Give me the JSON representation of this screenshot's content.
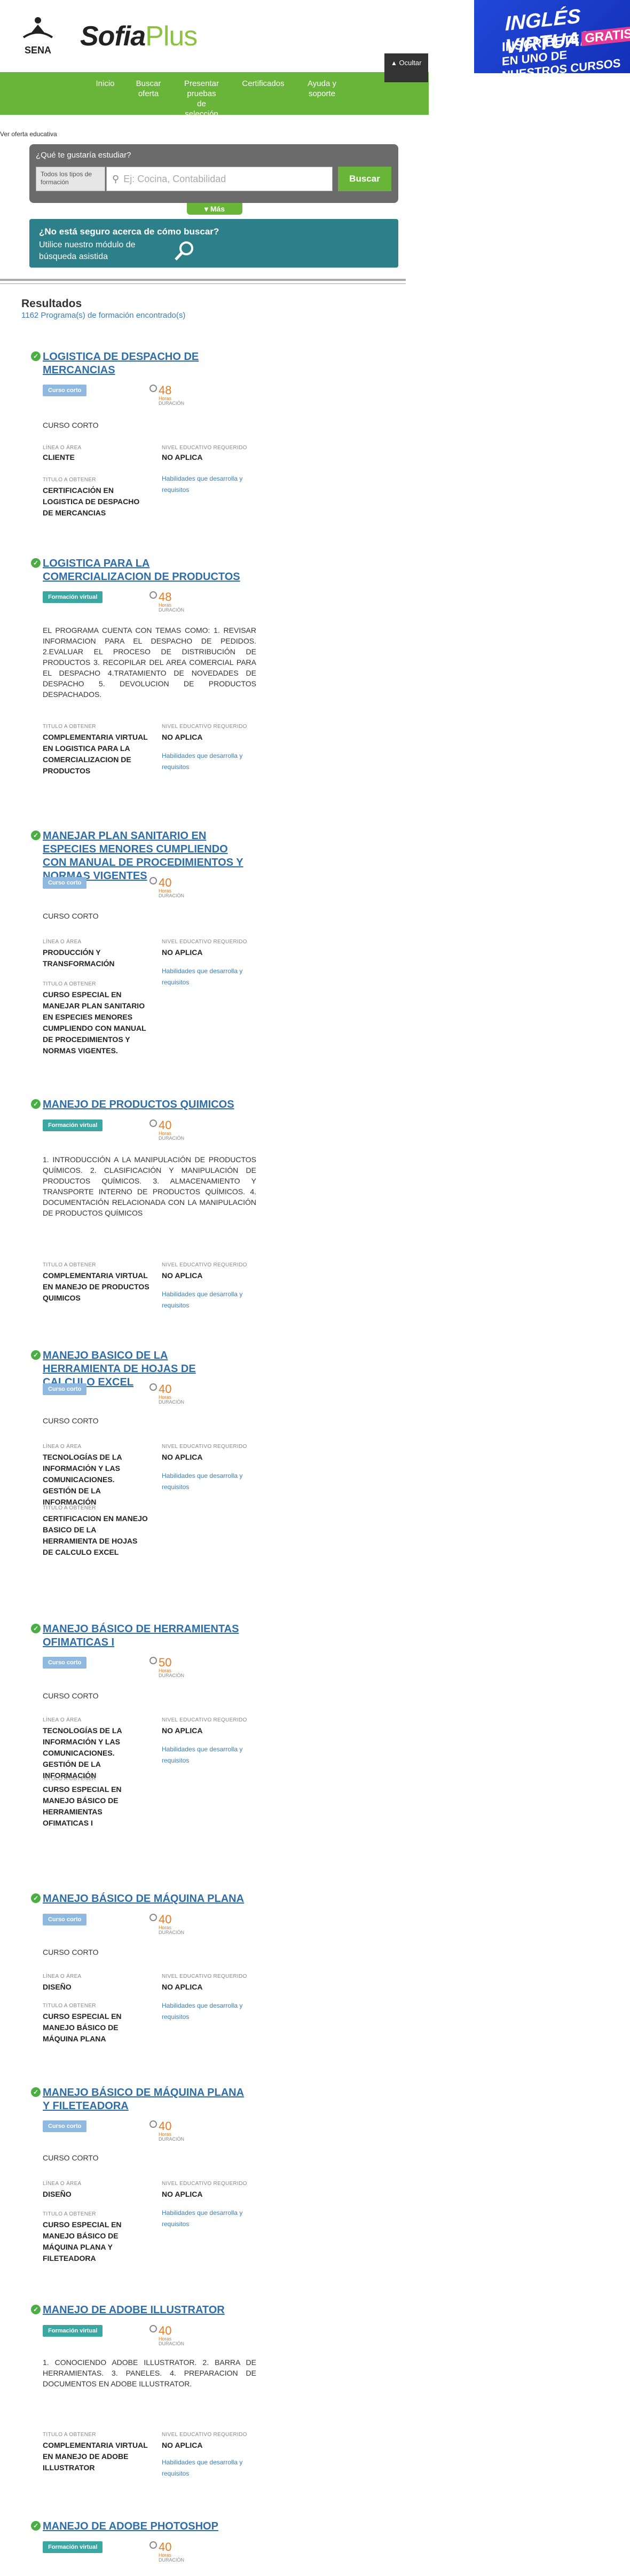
{
  "header": {
    "logo_sena": "SENA",
    "logo_sofia": "Sofia",
    "logo_plus": "Plus",
    "banner": {
      "line1": "INGLÉS VIRTUAL",
      "line2": "INSCRÍBETE",
      "line2_badge": "GRATIS",
      "line3": "EN UNO DE NUESTROS CURSOS"
    },
    "close_ad": "Ocultar"
  },
  "nav": [
    {
      "label": "Inicio"
    },
    {
      "label": "Buscar oferta"
    },
    {
      "label": "Presentar pruebas de selección"
    },
    {
      "label": "Certificados"
    },
    {
      "label": "Ayuda y soporte"
    }
  ],
  "breadcrumb": "Ver oferta educativa",
  "search": {
    "question": "¿Qué te gustaría estudiar?",
    "type_label": "Todos los tipos de formación",
    "placeholder": "Ej: Cocina, Contabilidad",
    "button": "Buscar",
    "more": "Más"
  },
  "assist": {
    "title": "¿No está seguro acerca de cómo buscar?",
    "text": "Utilice nuestro módulo de búsqueda asistida"
  },
  "results": {
    "heading": "Resultados",
    "count": "1162 Programa(s) de formación encontrado(s)"
  },
  "labels": {
    "duration_unit": "Horas",
    "duration": "DURACIÓN",
    "area": "LÍNEA O ÁREA",
    "level": "NIVEL EDUCATIVO REQUERIDO",
    "title": "TITULO A OBTENER",
    "skills_link": "Habilidades que desarrolla y requisitos"
  },
  "courses": [
    {
      "title": "LOGISTICA DE DESPACHO DE MERCANCIAS",
      "badge": "Curso corto",
      "hours": "48",
      "desc": "CURSO CORTO",
      "area": "CLIENTE",
      "level": "NO APLICA",
      "obtain": "CERTIFICACIÓN EN LOGISTICA DE DESPACHO DE MERCANCIAS"
    },
    {
      "title": "LOGISTICA PARA LA COMERCIALIZACION DE PRODUCTOS",
      "badge": "Formación virtual",
      "hours": "48",
      "desc": "EL PROGRAMA CUENTA CON TEMAS COMO: 1. REVISAR INFORMACION PARA EL DESPACHO DE PEDIDOS. 2.EVALUAR EL PROCESO DE DISTRIBUCIÓN DE PRODUCTOS 3. RECOPILAR DEL AREA COMERCIAL PARA EL DESPACHO 4.TRATAMIENTO DE NOVEDADES DE DESPACHO 5. DEVOLUCION DE PRODUCTOS DESPACHADOS.",
      "area": "",
      "level": "NO APLICA",
      "obtain": "COMPLEMENTARIA VIRTUAL EN LOGISTICA PARA LA COMERCIALIZACION DE PRODUCTOS"
    },
    {
      "title": "MANEJAR PLAN SANITARIO EN ESPECIES MENORES CUMPLIENDO CON MANUAL DE PROCEDIMIENTOS Y NORMAS VIGENTES",
      "badge": "Curso corto",
      "hours": "40",
      "desc": "CURSO CORTO",
      "area": "PRODUCCIÓN Y TRANSFORMACIÓN",
      "level": "NO APLICA",
      "obtain": "CURSO ESPECIAL EN MANEJAR PLAN SANITARIO EN ESPECIES MENORES CUMPLIENDO CON MANUAL DE PROCEDIMIENTOS Y NORMAS VIGENTES."
    },
    {
      "title": "MANEJO DE PRODUCTOS QUIMICOS",
      "badge": "Formación virtual",
      "hours": "40",
      "desc": "1. INTRODUCCIÓN A LA MANIPULACIÓN DE PRODUCTOS QUÍMICOS. 2. CLASIFICACIÓN Y MANIPULACIÓN DE PRODUCTOS QUÍMICOS. 3. ALMACENAMIENTO Y TRANSPORTE INTERNO DE PRODUCTOS QUÍMICOS. 4. DOCUMENTACIÓN RELACIONADA CON LA MANIPULACIÓN DE PRODUCTOS QUÍMICOS",
      "area": "",
      "level": "NO APLICA",
      "obtain": "COMPLEMENTARIA VIRTUAL EN MANEJO DE PRODUCTOS QUIMICOS"
    },
    {
      "title": "MANEJO BASICO DE LA HERRAMIENTA DE HOJAS DE CALCULO EXCEL",
      "badge": "Curso corto",
      "hours": "40",
      "desc": "CURSO CORTO",
      "area": "TECNOLOGÍAS DE LA INFORMACIÓN Y LAS COMUNICACIONES. GESTIÓN DE LA INFORMACIÓN",
      "level": "NO APLICA",
      "obtain": "CERTIFICACION EN MANEJO BASICO DE LA HERRAMIENTA DE HOJAS DE CALCULO EXCEL"
    },
    {
      "title": "MANEJO BÁSICO DE HERRAMIENTAS OFIMATICAS I",
      "badge": "Curso corto",
      "hours": "50",
      "desc": "CURSO CORTO",
      "area": "TECNOLOGÍAS DE LA INFORMACIÓN Y LAS COMUNICACIONES. GESTIÓN DE LA INFORMACIÓN",
      "level": "NO APLICA",
      "obtain": "CURSO ESPECIAL EN MANEJO BÁSICO DE HERRAMIENTAS OFIMATICAS I"
    },
    {
      "title": "MANEJO BÁSICO DE MÁQUINA PLANA",
      "badge": "Curso corto",
      "hours": "40",
      "desc": "CURSO CORTO",
      "area": "DISEÑO",
      "level": "NO APLICA",
      "obtain": "CURSO ESPECIAL EN MANEJO BÁSICO DE MÁQUINA PLANA"
    },
    {
      "title": "MANEJO BÁSICO DE MÁQUINA PLANA Y FILETEADORA",
      "badge": "Curso corto",
      "hours": "40",
      "desc": "CURSO CORTO",
      "area": "DISEÑO",
      "level": "NO APLICA",
      "obtain": "CURSO ESPECIAL EN MANEJO BÁSICO DE MÁQUINA PLANA Y FILETEADORA"
    },
    {
      "title": "MANEJO DE ADOBE ILLUSTRATOR",
      "badge": "Formación virtual",
      "hours": "40",
      "desc": "1. CONOCIENDO ADOBE ILLUSTRATOR. 2. BARRA DE HERRAMIENTAS. 3. PANELES. 4. PREPARACION DE DOCUMENTOS EN ADOBE ILLUSTRATOR.",
      "area": "",
      "level": "NO APLICA",
      "obtain": "COMPLEMENTARIA VIRTUAL EN MANEJO DE ADOBE ILLUSTRATOR"
    },
    {
      "title": "MANEJO DE ADOBE PHOTOSHOP",
      "badge": "Formación virtual",
      "hours": "40",
      "desc": "",
      "area": "",
      "level": "",
      "obtain": ""
    }
  ]
}
